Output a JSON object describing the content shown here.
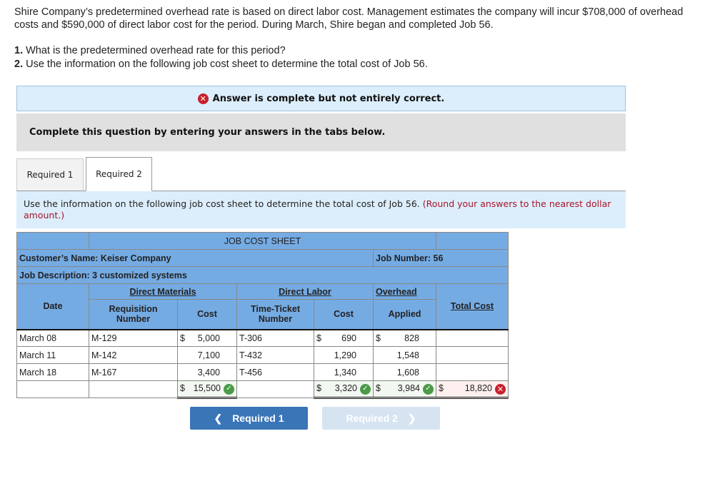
{
  "problem": {
    "intro": "Shire Company’s predetermined overhead rate is based on direct labor cost. Management estimates the company will incur $708,000 of overhead costs and $590,000 of direct labor cost for the period. During March, Shire began and completed Job 56.",
    "questions": [
      {
        "num": "1.",
        "text": " What is the predetermined overhead rate for this period?"
      },
      {
        "num": "2.",
        "text": " Use the information on the following job cost sheet to determine the total cost of Job 56."
      }
    ]
  },
  "feedback": {
    "status_icon": "x-circle-icon",
    "message": "Answer is complete but not entirely correct."
  },
  "instruction": "Complete this question by entering your answers in the tabs below.",
  "tabs": [
    {
      "label": "Required 1",
      "active": false
    },
    {
      "label": "Required 2",
      "active": true
    }
  ],
  "description": {
    "text": "Use the information on the following job cost sheet to determine the total cost of Job 56. ",
    "note": "(Round your answers to the nearest dollar amount.)"
  },
  "job_cost_sheet": {
    "title": "JOB COST SHEET",
    "customer": "Customer’s Name: Keiser Company",
    "job_number": "Job Number: 56",
    "job_description": "Job Description: 3 customized systems",
    "headers": {
      "date": "Date",
      "direct_materials": "Direct Materials",
      "direct_labor": "Direct Labor",
      "overhead": "Overhead",
      "total_cost": "Total Cost",
      "requisition_number": "Requisition Number",
      "dm_cost": "Cost",
      "time_ticket_number": "Time-Ticket Number",
      "dl_cost": "Cost",
      "applied": "Applied"
    },
    "rows": [
      {
        "date": "March 08",
        "req": "M-129",
        "dm_sym": "$",
        "dm_cost": "5,000",
        "tt": "T-306",
        "dl_sym": "$",
        "dl_cost": "690",
        "oh_sym": "$",
        "oh": "828"
      },
      {
        "date": "March 11",
        "req": "M-142",
        "dm_sym": "",
        "dm_cost": "7,100",
        "tt": "T-432",
        "dl_sym": "",
        "dl_cost": "1,290",
        "oh_sym": "",
        "oh": "1,548"
      },
      {
        "date": "March 18",
        "req": "M-167",
        "dm_sym": "",
        "dm_cost": "3,400",
        "tt": "T-456",
        "dl_sym": "",
        "dl_cost": "1,340",
        "oh_sym": "",
        "oh": "1,608"
      }
    ],
    "totals": {
      "dm_sym": "$",
      "dm_total": "15,500",
      "dm_status": "correct",
      "dl_sym": "$",
      "dl_total": "3,320",
      "dl_status": "correct",
      "oh_sym": "$",
      "oh_total": "3,984",
      "oh_status": "correct",
      "total_sym": "$",
      "total_cost": "18,820",
      "total_status": "incorrect"
    }
  },
  "nav": {
    "prev_label": "Required 1",
    "prev_icon": "chevron-left-icon",
    "next_label": "Required 2",
    "next_icon": "chevron-right-icon",
    "next_disabled": true
  },
  "colors": {
    "table_header": "#75abe3",
    "banner_bg": "#dceefb",
    "correct": "#4a9a47",
    "incorrect": "#c8202b",
    "note_red": "#a8142b",
    "button_primary": "#3a75b8",
    "button_disabled": "#d6e4f2"
  }
}
